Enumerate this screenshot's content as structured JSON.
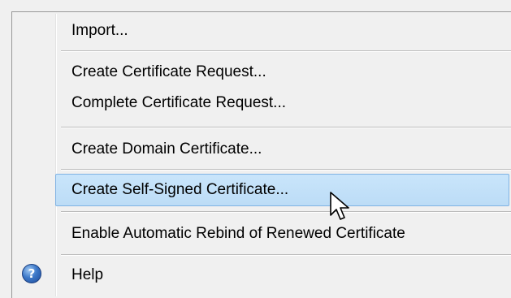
{
  "menu": {
    "items": [
      {
        "label": "Import..."
      },
      {
        "label": "Create Certificate Request..."
      },
      {
        "label": "Complete Certificate Request..."
      },
      {
        "label": "Create Domain Certificate..."
      },
      {
        "label": "Create Self-Signed Certificate..."
      },
      {
        "label": "Enable Automatic Rebind of Renewed Certificate"
      },
      {
        "label": "Help"
      }
    ],
    "selected_item": "Create Self-Signed Certificate...",
    "help_icon_glyph": "?"
  },
  "colors": {
    "highlight": "#c5e1f9",
    "highlight_border": "#7fb2e3",
    "background": "#f0f0f0"
  }
}
